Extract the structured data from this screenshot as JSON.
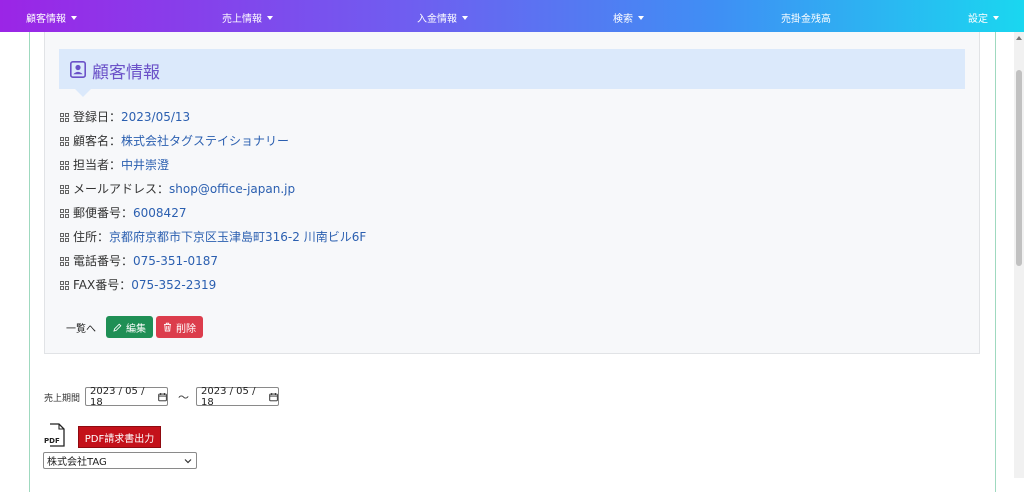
{
  "nav": {
    "items": [
      {
        "label": "顧客情報",
        "dropdown": true
      },
      {
        "label": "売上情報",
        "dropdown": true
      },
      {
        "label": "入金情報",
        "dropdown": true
      },
      {
        "label": "検索",
        "dropdown": true
      },
      {
        "label": "売掛金残高",
        "dropdown": false
      },
      {
        "label": "設定",
        "dropdown": true
      }
    ]
  },
  "card": {
    "title": "顧客情報",
    "fields": [
      {
        "label": "登録日：",
        "value": "2023/05/13"
      },
      {
        "label": "顧客名：",
        "value": "株式会社タグステイショナリー"
      },
      {
        "label": "担当者：",
        "value": "中井崇澄"
      },
      {
        "label": "メールアドレス：",
        "value": "shop@office-japan.jp"
      },
      {
        "label": "郵便番号：",
        "value": "6008427"
      },
      {
        "label": "住所：",
        "value": "京都府京都市下京区玉津島町316-2 川南ビル6F"
      },
      {
        "label": "電話番号：",
        "value": "075-351-0187"
      },
      {
        "label": "FAX番号：",
        "value": "075-352-2319"
      }
    ],
    "back_label": "一覧へ",
    "edit_label": "編集",
    "delete_label": "削除"
  },
  "sales": {
    "period_label": "売上期間",
    "date_from": "2023 / 05 / 18",
    "tilde": "〜",
    "date_to": "2023 / 05 / 18",
    "pdf_icon_text": "PDF",
    "pdf_button_label": "PDF請求書出力",
    "customer_select_value": "株式会社TAG"
  },
  "colors": {
    "edit": "#1f8f55",
    "delete": "#dc3d4c",
    "pdf": "#c4111a",
    "value_text": "#2b5fb0",
    "title_text": "#6b52c8"
  }
}
